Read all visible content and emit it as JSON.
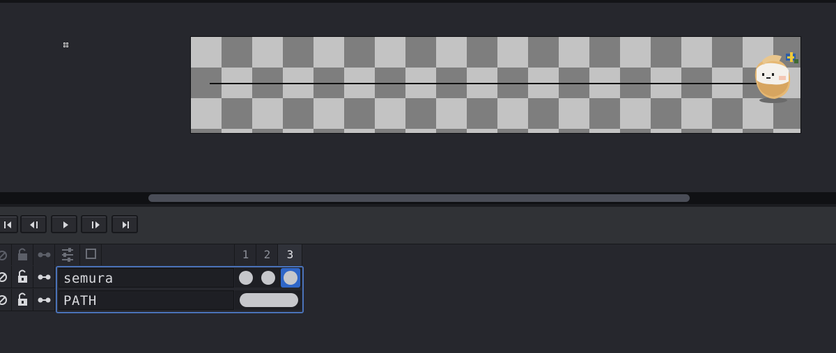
{
  "canvas": {
    "checker_dark": "#7e7e7e",
    "checker_light": "#c3c3c3",
    "crosshair_icon": "crosshair-icon",
    "sprite_name": "semura"
  },
  "transport": {
    "buttons": [
      {
        "name": "first-frame-button",
        "icon": "first-frame-icon"
      },
      {
        "name": "previous-frame-button",
        "icon": "previous-frame-icon"
      },
      {
        "name": "play-button",
        "icon": "play-icon"
      },
      {
        "name": "next-frame-button",
        "icon": "next-frame-icon"
      },
      {
        "name": "last-frame-button",
        "icon": "last-frame-icon"
      }
    ]
  },
  "timeline": {
    "header_icons": [
      "visibility-icon",
      "lock-icon",
      "continuous-icon",
      "layer-settings-icon",
      "layer-group-icon"
    ],
    "frames": [
      "1",
      "2",
      "3"
    ],
    "current_frame": "3",
    "selection_color": "#4a72b8",
    "layers": [
      {
        "name": "semura",
        "cels": [
          "1",
          "2",
          "3"
        ],
        "selected_cel": "3"
      },
      {
        "name": "PATH",
        "cels": [
          "1-3 linked"
        ]
      }
    ]
  }
}
